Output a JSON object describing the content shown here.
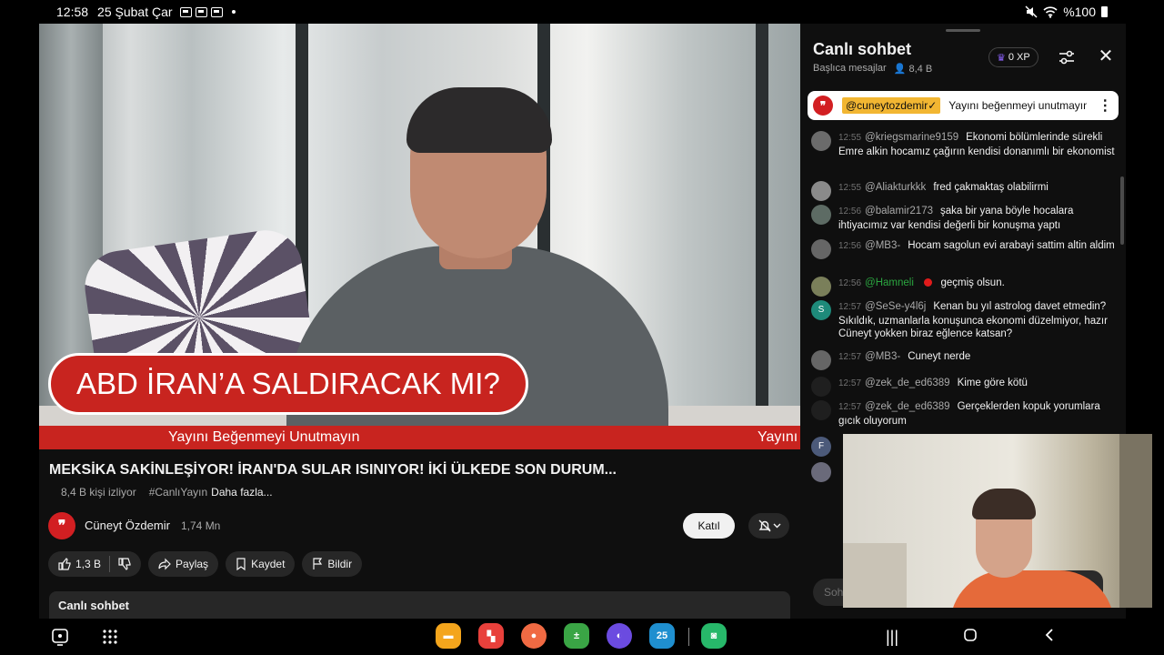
{
  "status_bar": {
    "time": "12:58",
    "date": "25 Şubat Çar",
    "battery": "%100"
  },
  "video": {
    "headline": "ABD İRAN’A SALDIRACAK MI?",
    "ticker_text": "Yayını Beğenmeyi Unutmayın",
    "ticker_text_2": "Yayını"
  },
  "video_info": {
    "title": "MEKSİKA SAKİNLEŞİYOR! İRAN'DA SULAR ISINIYOR! İKİ ÜLKEDE SON DURUM...",
    "viewers": "8,4 B kişi izliyor",
    "hashtag": "#CanlıYayın",
    "more": "Daha fazla...",
    "channel_name": "Cüneyt Özdemir",
    "subscribers": "1,74 Mn",
    "join_label": "Katıl",
    "likes": "1,3 B",
    "share_label": "Paylaş",
    "save_label": "Kaydet",
    "report_label": "Bildir",
    "live_chat_card": "Canlı sohbet"
  },
  "chat": {
    "title": "Canlı sohbet",
    "filter_label": "Başlıca mesajlar",
    "viewer_count": "8,4 B",
    "xp": "0 XP",
    "pinned": {
      "author": "@cuneytozdemir✓",
      "text": "Yayını beğenmeyi unutmayın"
    },
    "messages": [
      {
        "time": "12:55",
        "author": "@kriegsmarine9159",
        "text": "Ekonomi bölümlerinde sürekli Emre alkin hocamız çağırın kendisi donanımlı bir ekonomist"
      },
      {
        "time": "12:55",
        "author": "@Aliakturkkk",
        "text": "fred çakmaktaş olabilirmi"
      },
      {
        "time": "12:56",
        "author": "@balamir2173",
        "text": "şaka bir yana böyle hocalara ihtiyacımız var kendisi değerli bir konuşma yaptı"
      },
      {
        "time": "12:56",
        "author": "@MB3-",
        "text": "Hocam sagolun evi arabayi sattim altin aldim"
      },
      {
        "time": "12:56",
        "author": "@Hamneli",
        "text": "geçmiş olsun."
      },
      {
        "time": "12:57",
        "author": "@SeSe-y4l6j",
        "avatar_letter": "S",
        "text": "Kenan bu yıl astrolog davet etmedin? Sıkıldık, uzmanlarla konuşunca ekonomi düzelmiyor, hazır Cüneyt yokken biraz eğlence katsan?"
      },
      {
        "time": "12:57",
        "author": "@MB3-",
        "text": "Cuneyt nerde"
      },
      {
        "time": "12:57",
        "author": "@zek_de_ed6389",
        "text": "Kime göre kötü"
      },
      {
        "time": "12:57",
        "author": "@zek_de_ed6389",
        "text": "Gerçeklerden kopuk yorumlara gıcık oluyorum"
      }
    ],
    "partial_avatar_letter": "F",
    "input_placeholder": "Soh"
  },
  "dock": {
    "calendar_day": "25"
  },
  "colors": {
    "accent_red": "#c8241f",
    "pinned_author_bg": "#f2b632",
    "moderator_green": "#2ba640"
  }
}
